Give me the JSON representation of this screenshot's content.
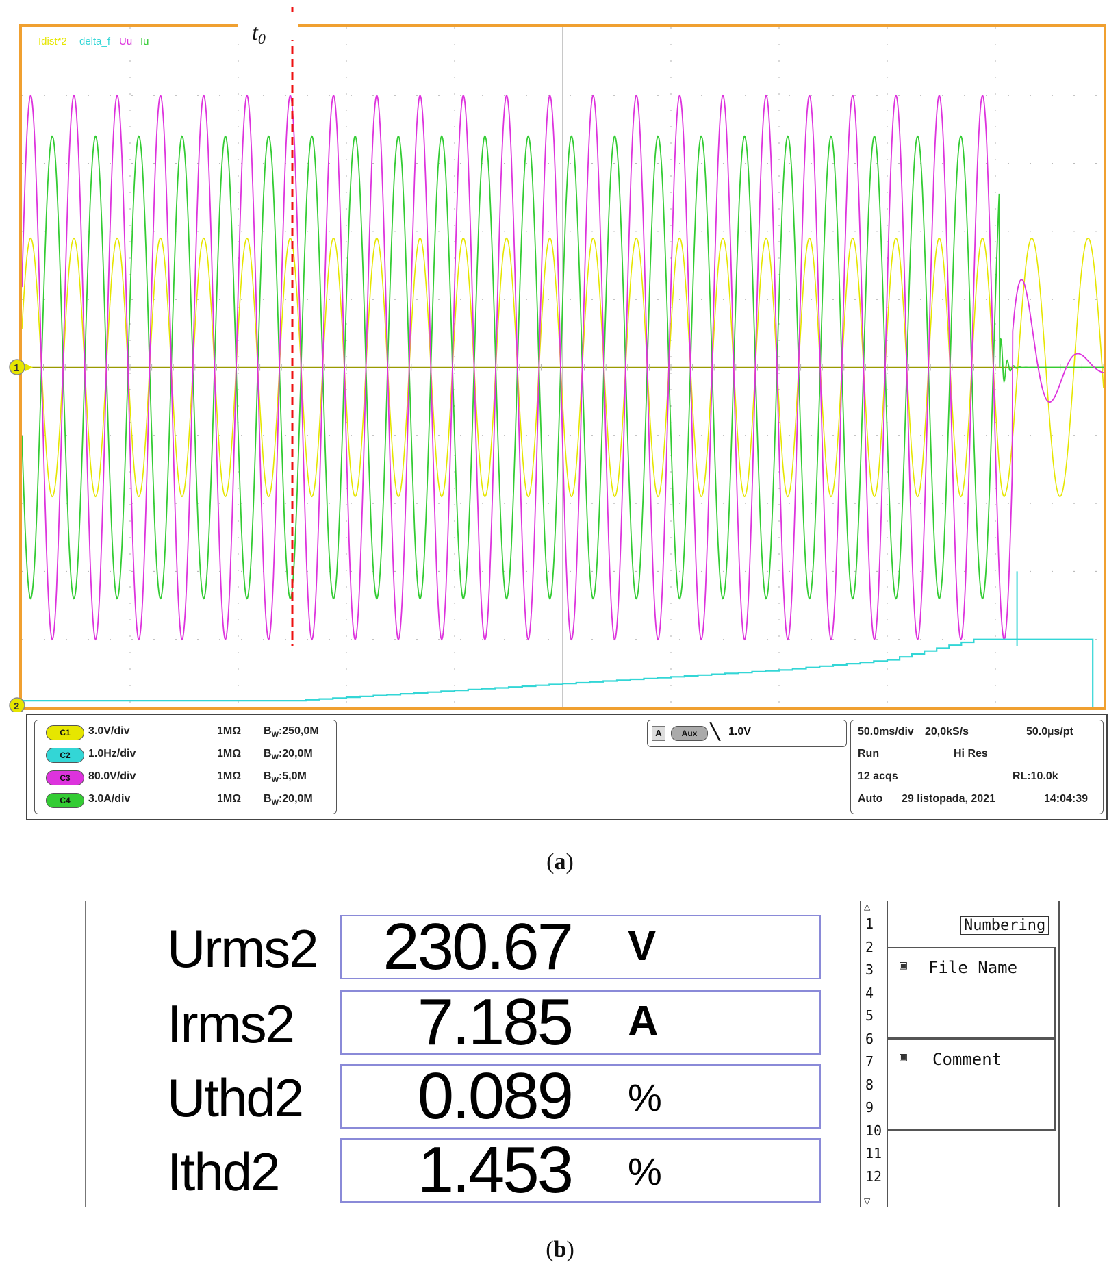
{
  "scope": {
    "legend": [
      "Idist*2",
      "delta_f",
      "Uu",
      "Iu"
    ],
    "marker_label": "t",
    "marker_sub": "0",
    "ch1_marker": "1",
    "ch2_marker": "2",
    "channels": [
      {
        "badge": "C1",
        "scale": "3.0V/div",
        "impedance": "1MΩ",
        "bw_prefix": "B",
        "bw_sub": "W",
        "bw_value": ":250,0M",
        "color": "#e6e600"
      },
      {
        "badge": "C2",
        "scale": "1.0Hz/div",
        "impedance": "1MΩ",
        "bw_prefix": "B",
        "bw_sub": "W",
        "bw_value": ":20,0M",
        "color": "#33d6d6"
      },
      {
        "badge": "C3",
        "scale": "80.0V/div",
        "impedance": "1MΩ",
        "bw_prefix": "B",
        "bw_sub": "W",
        "bw_value": ":5,0M",
        "color": "#dd33dd"
      },
      {
        "badge": "C4",
        "scale": "3.0A/div",
        "impedance": "1MΩ",
        "bw_prefix": "B",
        "bw_sub": "W",
        "bw_value": ":20,0M",
        "color": "#33cc33"
      }
    ],
    "trigger": {
      "mode": "A",
      "source": "Aux",
      "slope": "╲",
      "level": "1.0V"
    },
    "timebase": {
      "timediv": "50.0ms/div",
      "rate": "20,0kS/s",
      "ptspacing": "50.0µs/pt",
      "state": "Run",
      "acqmode": "Hi Res",
      "acqs": "12 acqs",
      "rl": "RL:10.0k",
      "trigmode": "Auto",
      "date": "29 listopada, 2021",
      "time": "14:04:39"
    },
    "colors": {
      "frame": "#f0a030",
      "grid": "#b0b0b0",
      "marker": "#ee1111",
      "zero": "#999900"
    }
  },
  "caption_a_open": "(",
  "caption_a_letter": "a",
  "caption_a_close": ")",
  "caption_b_open": "(",
  "caption_b_letter": "b",
  "caption_b_close": ")",
  "meter": {
    "rows": [
      {
        "label": "Urms2",
        "value": "230.67",
        "unit": "V"
      },
      {
        "label": "Irms2",
        "value": "7.185",
        "unit": "A"
      },
      {
        "label": "Uthd2",
        "value": "0.089",
        "unit": "%"
      },
      {
        "label": "Ithd2",
        "value": "1.453",
        "unit": "%"
      }
    ],
    "numbers": [
      "1",
      "2",
      "3",
      "4",
      "5",
      "6",
      "7",
      "8",
      "9",
      "10",
      "11",
      "12"
    ],
    "numbering_label": "Numbering",
    "file_name_label": "File Name",
    "comment_label": "Comment"
  },
  "chart_data": {
    "type": "line",
    "title": "",
    "xlabel": "",
    "ylabel": "",
    "x_unit": "ms",
    "x_range": [
      0,
      500
    ],
    "y_unit": "div",
    "y_range": [
      -5,
      5
    ],
    "marker_t0_x": 125,
    "series": [
      {
        "name": "Idist*2",
        "channel": "C1",
        "color": "#e6e600",
        "frequency_hz": 50,
        "amplitude_div": 1.9,
        "period_ms_after_stop": 26,
        "stop_x": 455
      },
      {
        "name": "Uu",
        "channel": "C3",
        "color": "#dd33dd",
        "frequency_hz": 50,
        "amplitude_div": 4.0,
        "stop_x": 458
      },
      {
        "name": "Iu",
        "channel": "C4",
        "color": "#33cc33",
        "frequency_hz": 50,
        "amplitude_div": 3.4,
        "stop_x": 452
      },
      {
        "name": "delta_f",
        "channel": "C2",
        "color": "#33d6d6",
        "x": [
          0,
          100,
          125,
          150,
          200,
          250,
          300,
          350,
          400,
          440,
          460,
          470
        ],
        "y": [
          -4.9,
          -4.9,
          -4.9,
          -4.85,
          -4.75,
          -4.65,
          -4.55,
          -4.45,
          -4.3,
          -4.0,
          -4.0,
          -4.0
        ]
      }
    ]
  }
}
